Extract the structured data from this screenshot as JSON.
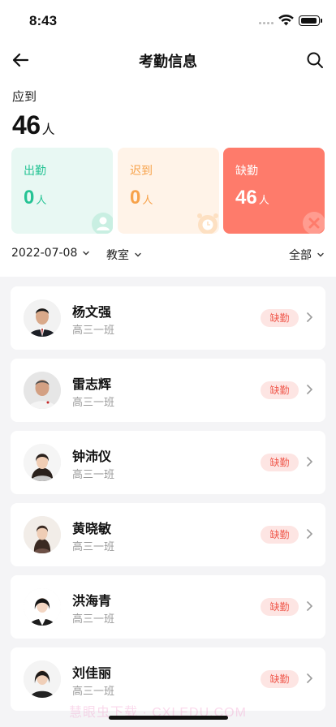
{
  "status": {
    "time": "8:43"
  },
  "nav": {
    "title": "考勤信息"
  },
  "summary": {
    "expected_label": "应到",
    "expected_count": "46",
    "unit": "人"
  },
  "cards": [
    {
      "label": "出勤",
      "count": "0",
      "unit": "人"
    },
    {
      "label": "迟到",
      "count": "0",
      "unit": "人"
    },
    {
      "label": "缺勤",
      "count": "46",
      "unit": "人"
    }
  ],
  "filters": {
    "date": "2022-07-08",
    "room": "教室",
    "scope": "全部"
  },
  "students": [
    {
      "name": "杨文强",
      "class": "高三一班",
      "status": "缺勤"
    },
    {
      "name": "雷志辉",
      "class": "高三一班",
      "status": "缺勤"
    },
    {
      "name": "钟沛仪",
      "class": "高三一班",
      "status": "缺勤"
    },
    {
      "name": "黄晓敏",
      "class": "高三一班",
      "status": "缺勤"
    },
    {
      "name": "洪海青",
      "class": "高三一班",
      "status": "缺勤"
    },
    {
      "name": "刘佳丽",
      "class": "高三一班",
      "status": "缺勤"
    }
  ],
  "watermark": "慧眼虫下载 · CXLEDU.COM"
}
